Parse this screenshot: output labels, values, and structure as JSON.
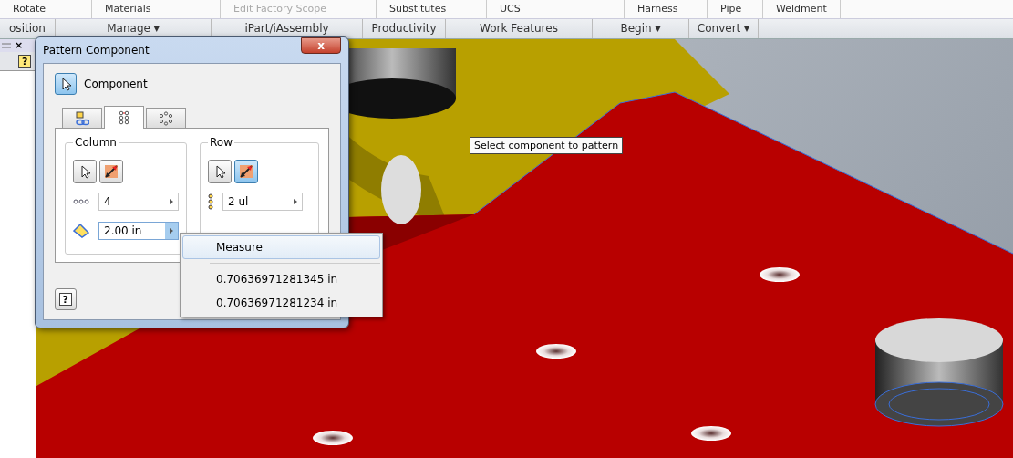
{
  "ribbon": {
    "tools": [
      "Rotate",
      "Materials",
      "Edit Factory Scope",
      "Substitutes",
      "UCS",
      "Harness",
      "Pipe",
      "Weldment"
    ],
    "tool_disabled": [
      false,
      false,
      true,
      false,
      false,
      false,
      false,
      false
    ],
    "panels": [
      {
        "label": "osition",
        "dropdown": false
      },
      {
        "label": "Manage",
        "dropdown": true
      },
      {
        "label": "iPart/iAssembly",
        "dropdown": false
      },
      {
        "label": "Productivity",
        "dropdown": false
      },
      {
        "label": "Work Features",
        "dropdown": false
      },
      {
        "label": "Begin",
        "dropdown": true
      },
      {
        "label": "Convert",
        "dropdown": true
      }
    ],
    "dropdown_glyph": "▾"
  },
  "browser_pane": {
    "close_glyph": "×",
    "help_glyph": "?"
  },
  "dialog": {
    "title": "Pattern Component",
    "close_glyph": "x",
    "help_glyph": "?",
    "component_button": {
      "label": "Component",
      "selected": true
    },
    "tabs": [
      {
        "kind": "associative",
        "selected": false
      },
      {
        "kind": "rectangular",
        "selected": true
      },
      {
        "kind": "circular",
        "selected": false
      }
    ],
    "column": {
      "title": "Column",
      "flip_selected": false,
      "count": "4",
      "spacing": "2.00 in",
      "spacing_menu_open": true
    },
    "row": {
      "title": "Row",
      "flip_selected": true,
      "count": "2 ul"
    }
  },
  "menu": {
    "items": [
      {
        "label": "Measure",
        "selected": true
      },
      {
        "label": "0.70636971281345 in",
        "selected": false
      },
      {
        "label": "0.70636971281234 in",
        "selected": false
      }
    ]
  },
  "tooltip": {
    "text": "Select component to pattern"
  }
}
